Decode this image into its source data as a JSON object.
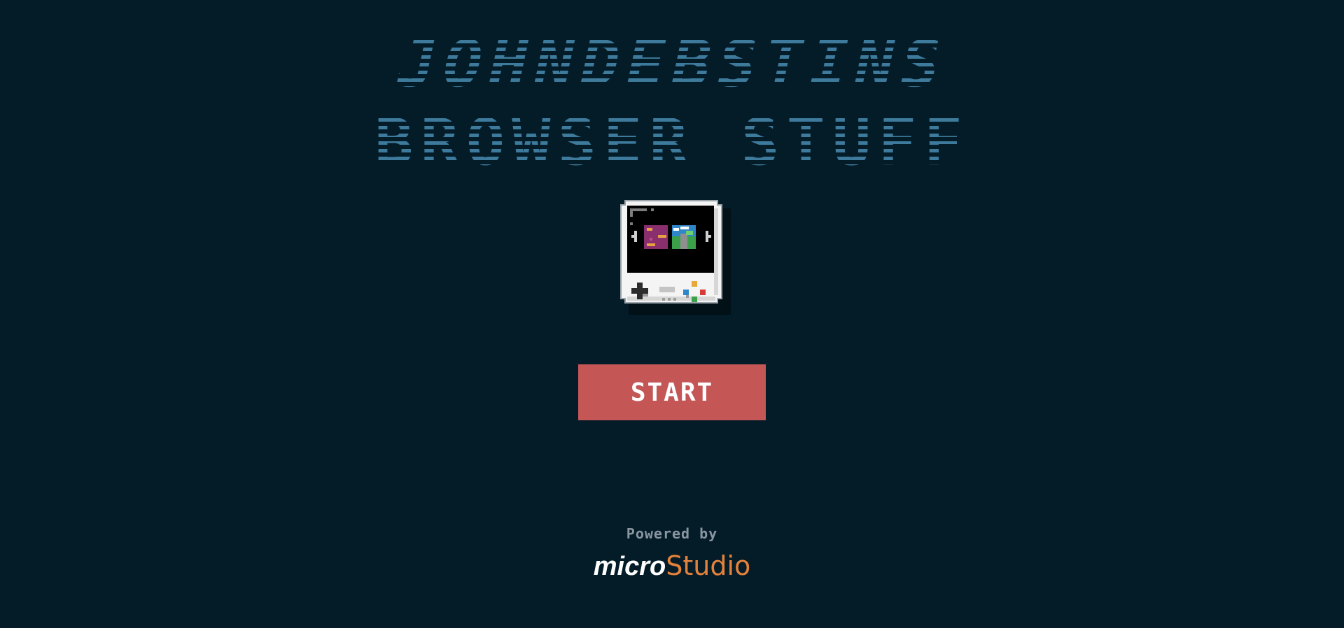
{
  "title": {
    "line1": "JOHNDEBSTINS",
    "line2": "BROWSER STUFF"
  },
  "icon": {
    "name": "handheld-console-icon"
  },
  "start_button": {
    "label": "START"
  },
  "footer": {
    "powered_by": "Powered by",
    "brand_part1": "micro",
    "brand_part2": "Studio"
  },
  "colors": {
    "background": "#041b28",
    "title": "#3d7a9b",
    "start_button": "#c45656",
    "brand_accent": "#e3823a",
    "powered_by_text": "#8a97a0"
  }
}
